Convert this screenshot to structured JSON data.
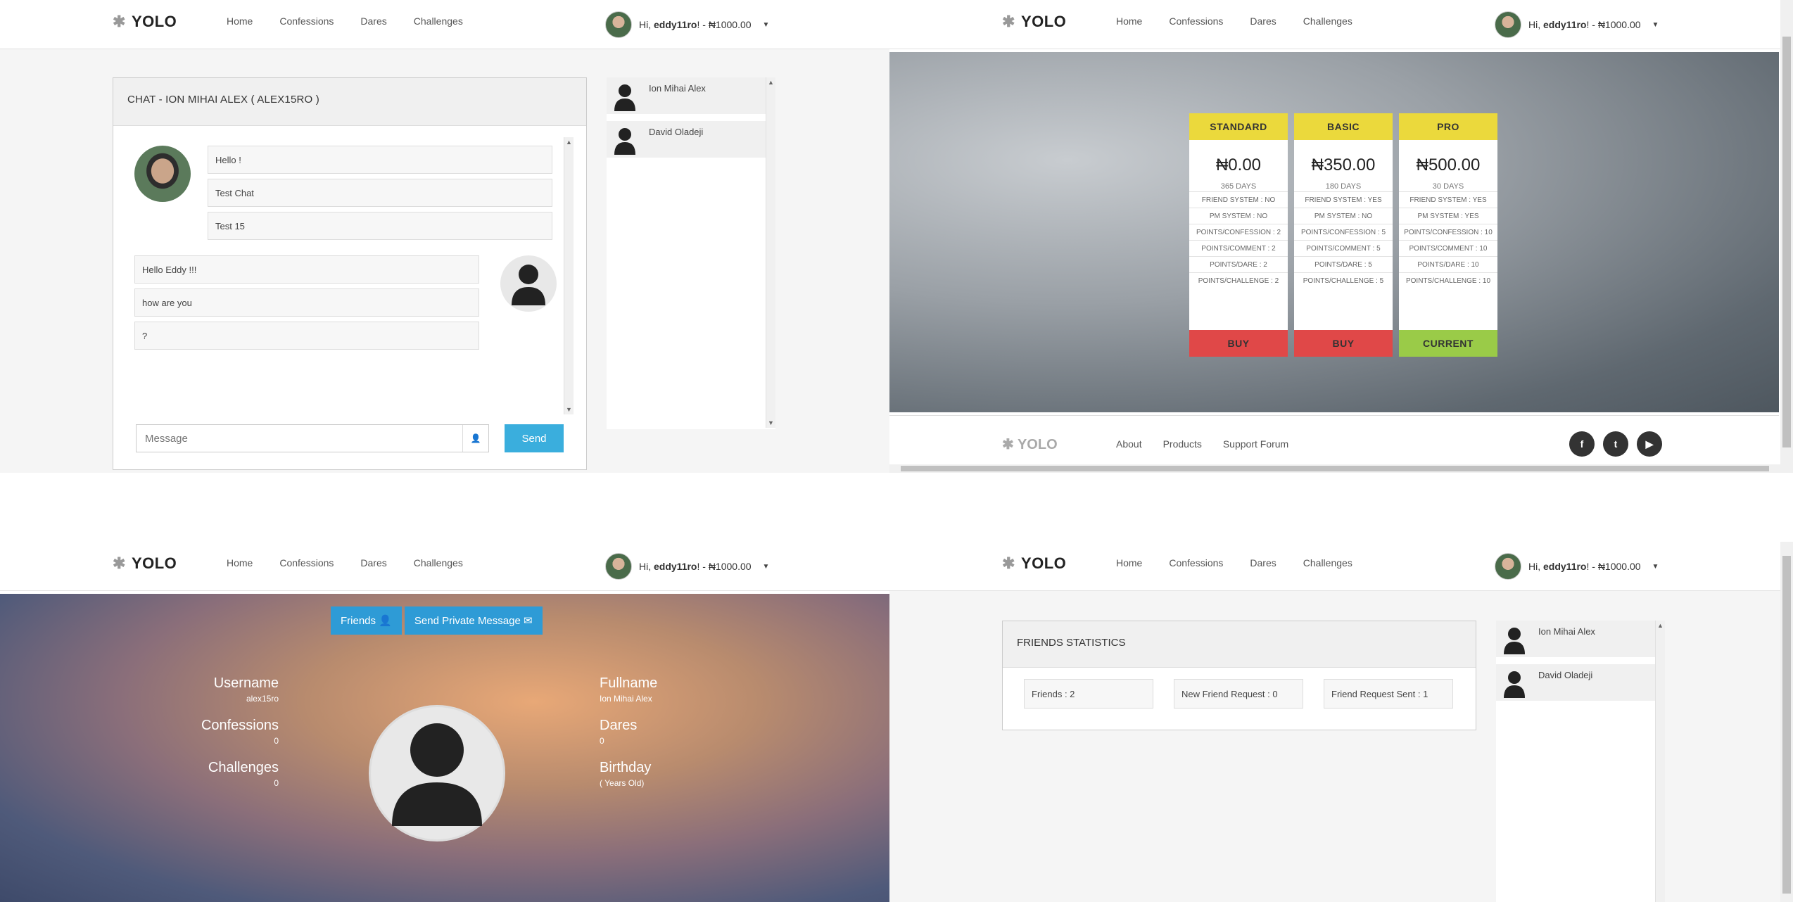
{
  "nav": {
    "brand": "YOLO",
    "links": [
      "Home",
      "Confessions",
      "Dares",
      "Challenges"
    ],
    "greeting": "Hi, ",
    "username": "eddy11ro",
    "balance": "! - ₦1000.00",
    "caret": "▼"
  },
  "chat": {
    "title": "CHAT - ION MIHAI ALEX ( ALEX15RO )",
    "sent_messages": [
      "Hello !",
      "Test Chat",
      "Test 15"
    ],
    "received_messages": [
      "Hello Eddy !!!",
      "how are you",
      "?"
    ],
    "input_placeholder": "Message",
    "send_label": "Send"
  },
  "friends": [
    {
      "name": "Ion Mihai Alex",
      "status_color": "#444444"
    },
    {
      "name": "David Oladeji",
      "status_color": "#e04848"
    }
  ],
  "pricing": {
    "plans": [
      {
        "name": "STANDARD",
        "price": "₦0.00",
        "duration": "365 DAYS",
        "features": [
          "FRIEND SYSTEM : NO",
          "PM SYSTEM : NO",
          "POINTS/CONFESSION : 2",
          "POINTS/COMMENT : 2",
          "POINTS/DARE : 2",
          "POINTS/CHALLENGE : 2"
        ],
        "action": "BUY",
        "action_color": "#e04848"
      },
      {
        "name": "BASIC",
        "price": "₦350.00",
        "duration": "180 DAYS",
        "features": [
          "FRIEND SYSTEM : YES",
          "PM SYSTEM : NO",
          "POINTS/CONFESSION : 5",
          "POINTS/COMMENT : 5",
          "POINTS/DARE : 5",
          "POINTS/CHALLENGE : 5"
        ],
        "action": "BUY",
        "action_color": "#e04848"
      },
      {
        "name": "PRO",
        "price": "₦500.00",
        "duration": "30 DAYS",
        "features": [
          "FRIEND SYSTEM : YES",
          "PM SYSTEM : YES",
          "POINTS/CONFESSION : 10",
          "POINTS/COMMENT : 10",
          "POINTS/DARE : 10",
          "POINTS/CHALLENGE : 10"
        ],
        "action": "CURRENT",
        "action_color": "#9acb48"
      }
    ]
  },
  "footer": {
    "brand": "YOLO",
    "links": [
      "About",
      "Products",
      "Support Forum"
    ],
    "social": [
      "facebook-icon",
      "twitter-icon",
      "youtube-icon"
    ]
  },
  "profile": {
    "friends_label": "Friends",
    "pm_label": "Send Private Message",
    "username_label": "Username",
    "username_value": "alex15ro",
    "confessions_label": "Confessions",
    "confessions_value": "0",
    "challenges_label": "Challenges",
    "challenges_value": "0",
    "fullname_label": "Fullname",
    "fullname_value": "Ion Mihai Alex",
    "dares_label": "Dares",
    "dares_value": "0",
    "birthday_label": "Birthday",
    "birthday_value": "( Years Old)"
  },
  "friend_stats": {
    "title": "FRIENDS STATISTICS",
    "friends": "Friends : 2",
    "new_requests": "New Friend Request : 0",
    "sent_requests": "Friend Request Sent : 1"
  },
  "colors": {
    "accent_blue": "#3aaedd",
    "plan_header": "#ebd93c",
    "buy_red": "#e04848",
    "current_green": "#9acb48"
  }
}
